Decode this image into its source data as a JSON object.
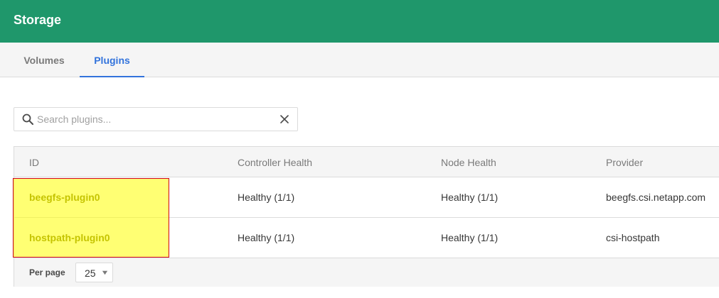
{
  "header": {
    "title": "Storage",
    "color": "#1f976b"
  },
  "tabs": [
    {
      "label": "Volumes",
      "active": false
    },
    {
      "label": "Plugins",
      "active": true
    }
  ],
  "search": {
    "placeholder": "Search plugins...",
    "value": ""
  },
  "table": {
    "columns": [
      "ID",
      "Controller Health",
      "Node Health",
      "Provider"
    ],
    "rows": [
      {
        "id": "beegfs-plugin0",
        "controller_health": "Healthy (1/1)",
        "node_health": "Healthy (1/1)",
        "provider": "beegfs.csi.netapp.com"
      },
      {
        "id": "hostpath-plugin0",
        "controller_health": "Healthy (1/1)",
        "node_health": "Healthy (1/1)",
        "provider": "csi-hostpath"
      }
    ]
  },
  "pagination": {
    "per_page_label": "Per page",
    "per_page_value": "25"
  },
  "icons": {
    "search": "search-icon",
    "clear": "close-icon",
    "select": "chevron-down-icon"
  },
  "colors": {
    "accent": "#3273dc",
    "id_text": "#7f7c00",
    "highlight": "#ffff00",
    "highlight_border": "#d0021b"
  }
}
